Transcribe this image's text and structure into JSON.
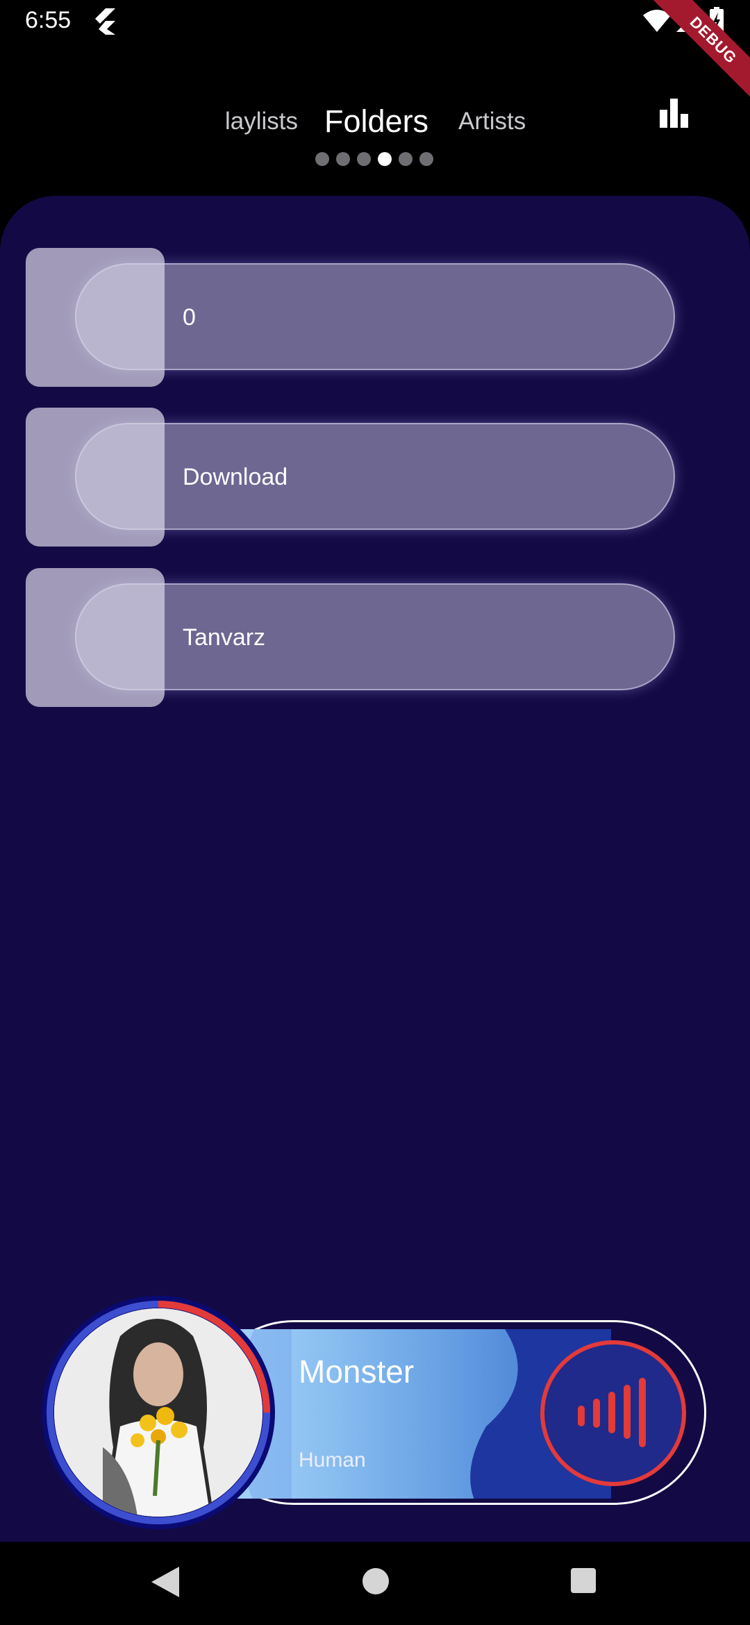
{
  "status_bar": {
    "time": "6:55",
    "debug_label": "DEBUG",
    "icons": [
      "flutter-icon",
      "wifi-icon",
      "signal-icon",
      "battery-charging-icon"
    ]
  },
  "header": {
    "tabs": {
      "previous": "laylists",
      "current": "Folders",
      "next": "Artists"
    },
    "page_indicator": {
      "count": 6,
      "active_index": 3
    },
    "action_icon": "equalizer-icon"
  },
  "folders": [
    {
      "label": "0"
    },
    {
      "label": "Download"
    },
    {
      "label": "Tanvarz"
    }
  ],
  "player": {
    "title": "Monster",
    "artist": "Human",
    "progress": 0.25,
    "button_icon": "sound-wave-icon"
  },
  "colors": {
    "panel_bg": "#130a45",
    "accent_red": "#e33a3a",
    "player_gradient_start": "#a9d4fb",
    "player_gradient_end": "#3a6bc9"
  },
  "nav_bar": {
    "icons": [
      "back-icon",
      "home-icon",
      "recents-icon"
    ]
  }
}
